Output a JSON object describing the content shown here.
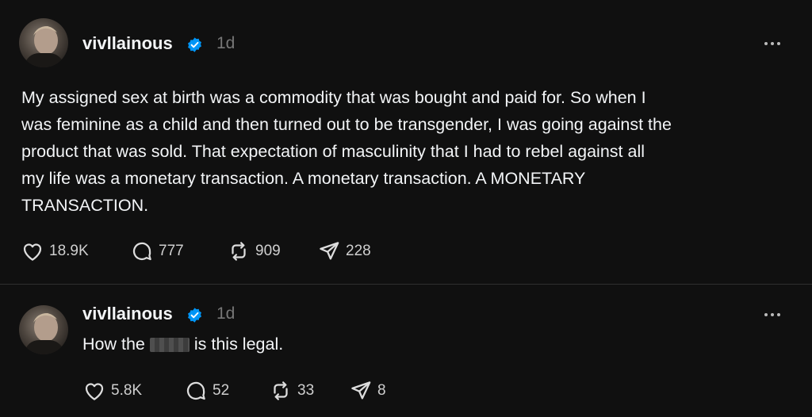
{
  "posts": [
    {
      "username": "vivllainous",
      "time": "1d",
      "text": "My assigned sex at birth was a commodity that was bought and paid for. So when I\nwas feminine as a child and then turned out to be transgender, I was going against the\nproduct that was sold. That expectation of masculinity that I had to rebel against all\nmy life was a monetary transaction. A monetary transaction. A MONETARY\nTRANSACTION.",
      "likes": "18.9K",
      "replies": "777",
      "reposts": "909",
      "shares": "228"
    },
    {
      "username": "vivllainous",
      "time": "1d",
      "text_before": "How the",
      "text_after": "is this legal.",
      "likes": "5.8K",
      "replies": "52",
      "reposts": "33",
      "shares": "8"
    }
  ],
  "colors": {
    "background": "#101010",
    "text": "#f3f5f7",
    "muted": "#777777",
    "verified": "#0095f6"
  },
  "icons": [
    "more-icon",
    "verified-icon",
    "heart-icon",
    "comment-icon",
    "repost-icon",
    "share-icon"
  ]
}
